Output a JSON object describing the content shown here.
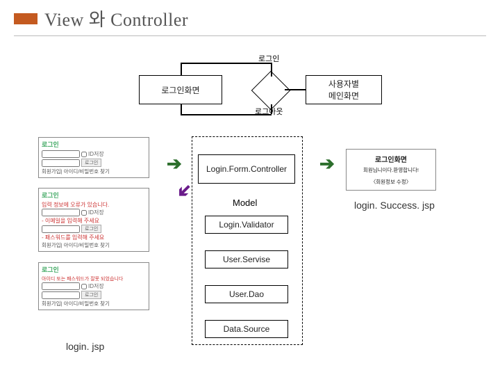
{
  "title": "View 와 Controller",
  "flow": {
    "login_box": "로그인화면",
    "user_main_box": "사용자별\n메인화면",
    "edge_login": "로그인",
    "edge_logout": "로그아웃"
  },
  "stack": {
    "controller": "Login.Form.Controller",
    "model_label": "Model",
    "validator": "Login.Validator",
    "service": "User.Servise",
    "dao": "User.Dao",
    "datasource": "Data.Source"
  },
  "left_caption": "login. jsp",
  "right_caption": "login. Success. jsp",
  "mini": {
    "title": "로그인",
    "id_save": "ID저장",
    "login_btn": "로그인",
    "links": "회원가입| 아이디/비밀번호 찾기",
    "err_blank": "입력 정보에 오류가 있습니다.",
    "err_email": "- 이메일을 입력해 주세요",
    "err_pw": "- 패스워드를 입력해 주세요",
    "err_wrong": "아이디 또는 패스워드가 잘못 되었습니다"
  },
  "success": {
    "title": "로그인화면",
    "welcome": "회원님니이다.환영합니다!",
    "edit": "〈회원정보 수정〉"
  }
}
